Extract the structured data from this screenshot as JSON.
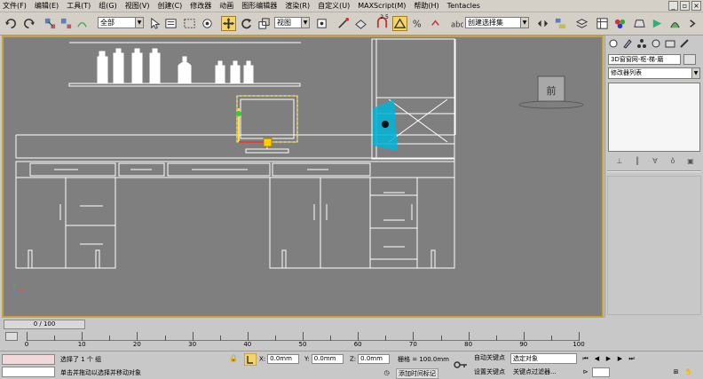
{
  "menu": [
    "文件(F)",
    "编辑(E)",
    "工具(T)",
    "组(G)",
    "视图(V)",
    "创建(C)",
    "修改器",
    "动画",
    "图形编辑器",
    "渲染(R)",
    "自定义(U)",
    "MAXScript(M)",
    "帮助(H)",
    "Tentacles"
  ],
  "toolbar": {
    "filter_value": "全部",
    "refcoord_value": "视图",
    "named_sel_placeholder": "创建选择集",
    "snap_label": "2.5"
  },
  "viewport": {
    "label": ""
  },
  "command_panel": {
    "object_name": "3D窗窗网-枢-梯-磨",
    "modifier_list": "修改器列表"
  },
  "timeline": {
    "slider_text": "0 / 100"
  },
  "ruler": {
    "ticks": [
      "0",
      "10",
      "20",
      "30",
      "40",
      "50",
      "60",
      "70",
      "80",
      "90",
      "100"
    ]
  },
  "status": {
    "selection": "选择了 1 个 组",
    "prompt": "单击并拖动以选择并移动对象",
    "x_label": "X:",
    "x_value": "0.0mm",
    "y_label": "Y:",
    "y_value": "0.0mm",
    "z_label": "Z:",
    "z_value": "0.0mm",
    "grid": "栅格 = 100.0mm",
    "time_tag": "添加时间标记",
    "auto_key": "自动关键点",
    "set_key": "设置关键点",
    "selected_set": "选定对象",
    "key_filters": "关键点过滤器..."
  },
  "colors": {
    "viewport_bg": "#7f7f7f",
    "viewport_border": "#c8a33a",
    "highlight": "#00b4d8"
  }
}
